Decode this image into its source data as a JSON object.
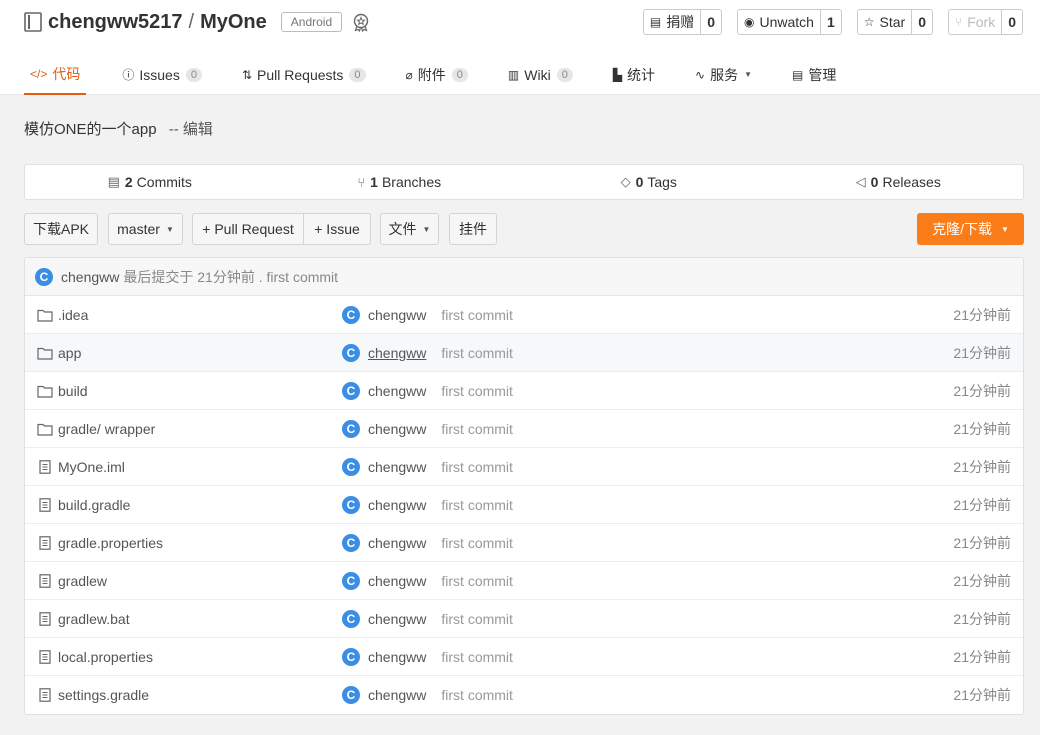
{
  "repo": {
    "owner": "chengww5217",
    "separator": "/",
    "name": "MyOne",
    "tag": "Android"
  },
  "actions": [
    {
      "icon": "donate-icon",
      "label": "捐赠",
      "count": "0"
    },
    {
      "icon": "eye-icon",
      "label": "Unwatch",
      "count": "1"
    },
    {
      "icon": "star-icon",
      "label": "Star",
      "count": "0"
    },
    {
      "icon": "fork-icon",
      "label": "Fork",
      "count": "0"
    }
  ],
  "tabs": [
    {
      "icon": "code-icon",
      "label": "代码",
      "badge": ""
    },
    {
      "icon": "issues-icon",
      "label": "Issues",
      "badge": "0"
    },
    {
      "icon": "pull-request-icon",
      "label": "Pull Requests",
      "badge": "0"
    },
    {
      "icon": "attachment-icon",
      "label": "附件",
      "badge": "0"
    },
    {
      "icon": "wiki-icon",
      "label": "Wiki",
      "badge": "0"
    },
    {
      "icon": "chart-icon",
      "label": "统计",
      "badge": ""
    },
    {
      "icon": "service-icon",
      "label": "服务",
      "badge": ""
    },
    {
      "icon": "manage-icon",
      "label": "管理",
      "badge": ""
    }
  ],
  "description": {
    "text": "模仿ONE的一个app",
    "edit": "-- 编辑"
  },
  "stats": [
    {
      "icon": "commits-icon",
      "count": "2",
      "label": "Commits"
    },
    {
      "icon": "branch-icon",
      "count": "1",
      "label": "Branches"
    },
    {
      "icon": "tag-icon",
      "count": "0",
      "label": "Tags"
    },
    {
      "icon": "release-icon",
      "count": "0",
      "label": "Releases"
    }
  ],
  "toolbar": {
    "download_apk": "下载APK",
    "branch": "master",
    "pull_request": "+ Pull Request",
    "issue": "+ Issue",
    "files": "文件",
    "widgets": "挂件",
    "clone": "克隆/下载"
  },
  "last_commit": {
    "avatar": "C",
    "author": "chengww",
    "text": "最后提交于 21分钟前 . first commit"
  },
  "files": [
    {
      "type": "folder",
      "name": ".idea",
      "avatar": "C",
      "author": "chengww",
      "message": "first commit",
      "time": "21分钟前"
    },
    {
      "type": "folder",
      "name": "app",
      "avatar": "C",
      "author": "chengww",
      "message": "first commit",
      "time": "21分钟前"
    },
    {
      "type": "folder",
      "name": "build",
      "avatar": "C",
      "author": "chengww",
      "message": "first commit",
      "time": "21分钟前"
    },
    {
      "type": "folder",
      "name": "gradle/ wrapper",
      "avatar": "C",
      "author": "chengww",
      "message": "first commit",
      "time": "21分钟前"
    },
    {
      "type": "file",
      "name": "MyOne.iml",
      "avatar": "C",
      "author": "chengww",
      "message": "first commit",
      "time": "21分钟前"
    },
    {
      "type": "file",
      "name": "build.gradle",
      "avatar": "C",
      "author": "chengww",
      "message": "first commit",
      "time": "21分钟前"
    },
    {
      "type": "file",
      "name": "gradle.properties",
      "avatar": "C",
      "author": "chengww",
      "message": "first commit",
      "time": "21分钟前"
    },
    {
      "type": "file",
      "name": "gradlew",
      "avatar": "C",
      "author": "chengww",
      "message": "first commit",
      "time": "21分钟前"
    },
    {
      "type": "file",
      "name": "gradlew.bat",
      "avatar": "C",
      "author": "chengww",
      "message": "first commit",
      "time": "21分钟前"
    },
    {
      "type": "file",
      "name": "local.properties",
      "avatar": "C",
      "author": "chengww",
      "message": "first commit",
      "time": "21分钟前"
    },
    {
      "type": "file",
      "name": "settings.gradle",
      "avatar": "C",
      "author": "chengww",
      "message": "first commit",
      "time": "21分钟前"
    }
  ],
  "colors": {
    "accent": "#e35d0e",
    "clone_button": "#fb7d1a",
    "avatar": "#3a8ee6"
  }
}
